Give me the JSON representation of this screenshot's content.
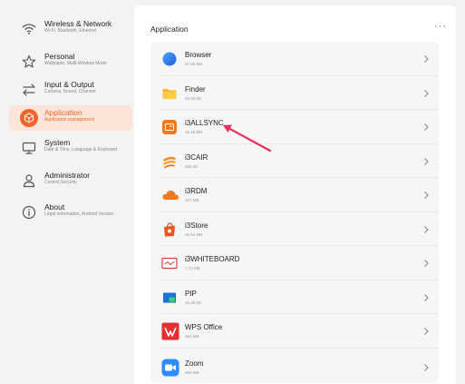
{
  "sidebar": {
    "items": [
      {
        "title": "Wireless & Network",
        "subtitle": "Wi-Fi, Bluetooth, Ethernet",
        "icon": "wifi-icon"
      },
      {
        "title": "Personal",
        "subtitle": "Wallpaper, Multi-Window Mode",
        "icon": "star-icon"
      },
      {
        "title": "Input & Output",
        "subtitle": "Camera, Sound, Channel",
        "icon": "swap-arrows-icon"
      },
      {
        "title": "Application",
        "subtitle": "Application management",
        "icon": "cube-icon"
      },
      {
        "title": "System",
        "subtitle": "Date & Time, Language & Keyboard",
        "icon": "monitor-icon"
      },
      {
        "title": "Administrator",
        "subtitle": "Control,Security",
        "icon": "user-icon"
      },
      {
        "title": "About",
        "subtitle": "Legal information, Android Version",
        "icon": "info-icon"
      }
    ],
    "active_index": 3
  },
  "main": {
    "title": "Application",
    "more_label": "···",
    "apps": [
      {
        "name": "Browser",
        "size": "37.05 MB",
        "icon": "browser-icon"
      },
      {
        "name": "Finder",
        "size": "40.06 kB",
        "icon": "folder-icon"
      },
      {
        "name": "i3ALLSYNC",
        "size": "15.19 MB",
        "icon": "i3allsync-icon"
      },
      {
        "name": "i3CAIR",
        "size": "305 kB",
        "icon": "i3cair-icon"
      },
      {
        "name": "i3RDM",
        "size": "121 MB",
        "icon": "cloud-icon"
      },
      {
        "name": "i3Store",
        "size": "26.54 MB",
        "icon": "store-bag-icon"
      },
      {
        "name": "i3WHITEBOARD",
        "size": "7.72 MB",
        "icon": "whiteboard-icon"
      },
      {
        "name": "PIP",
        "size": "16.38 kB",
        "icon": "pip-icon"
      },
      {
        "name": "WPS Office",
        "size": "353 MB",
        "icon": "wps-office-icon"
      },
      {
        "name": "Zoom",
        "size": "209 MB",
        "icon": "zoom-camera-icon"
      }
    ]
  },
  "colors": {
    "accent": "#f0652d",
    "active_bg": "#fae5d8",
    "annotation_arrow": "#e8315a"
  }
}
